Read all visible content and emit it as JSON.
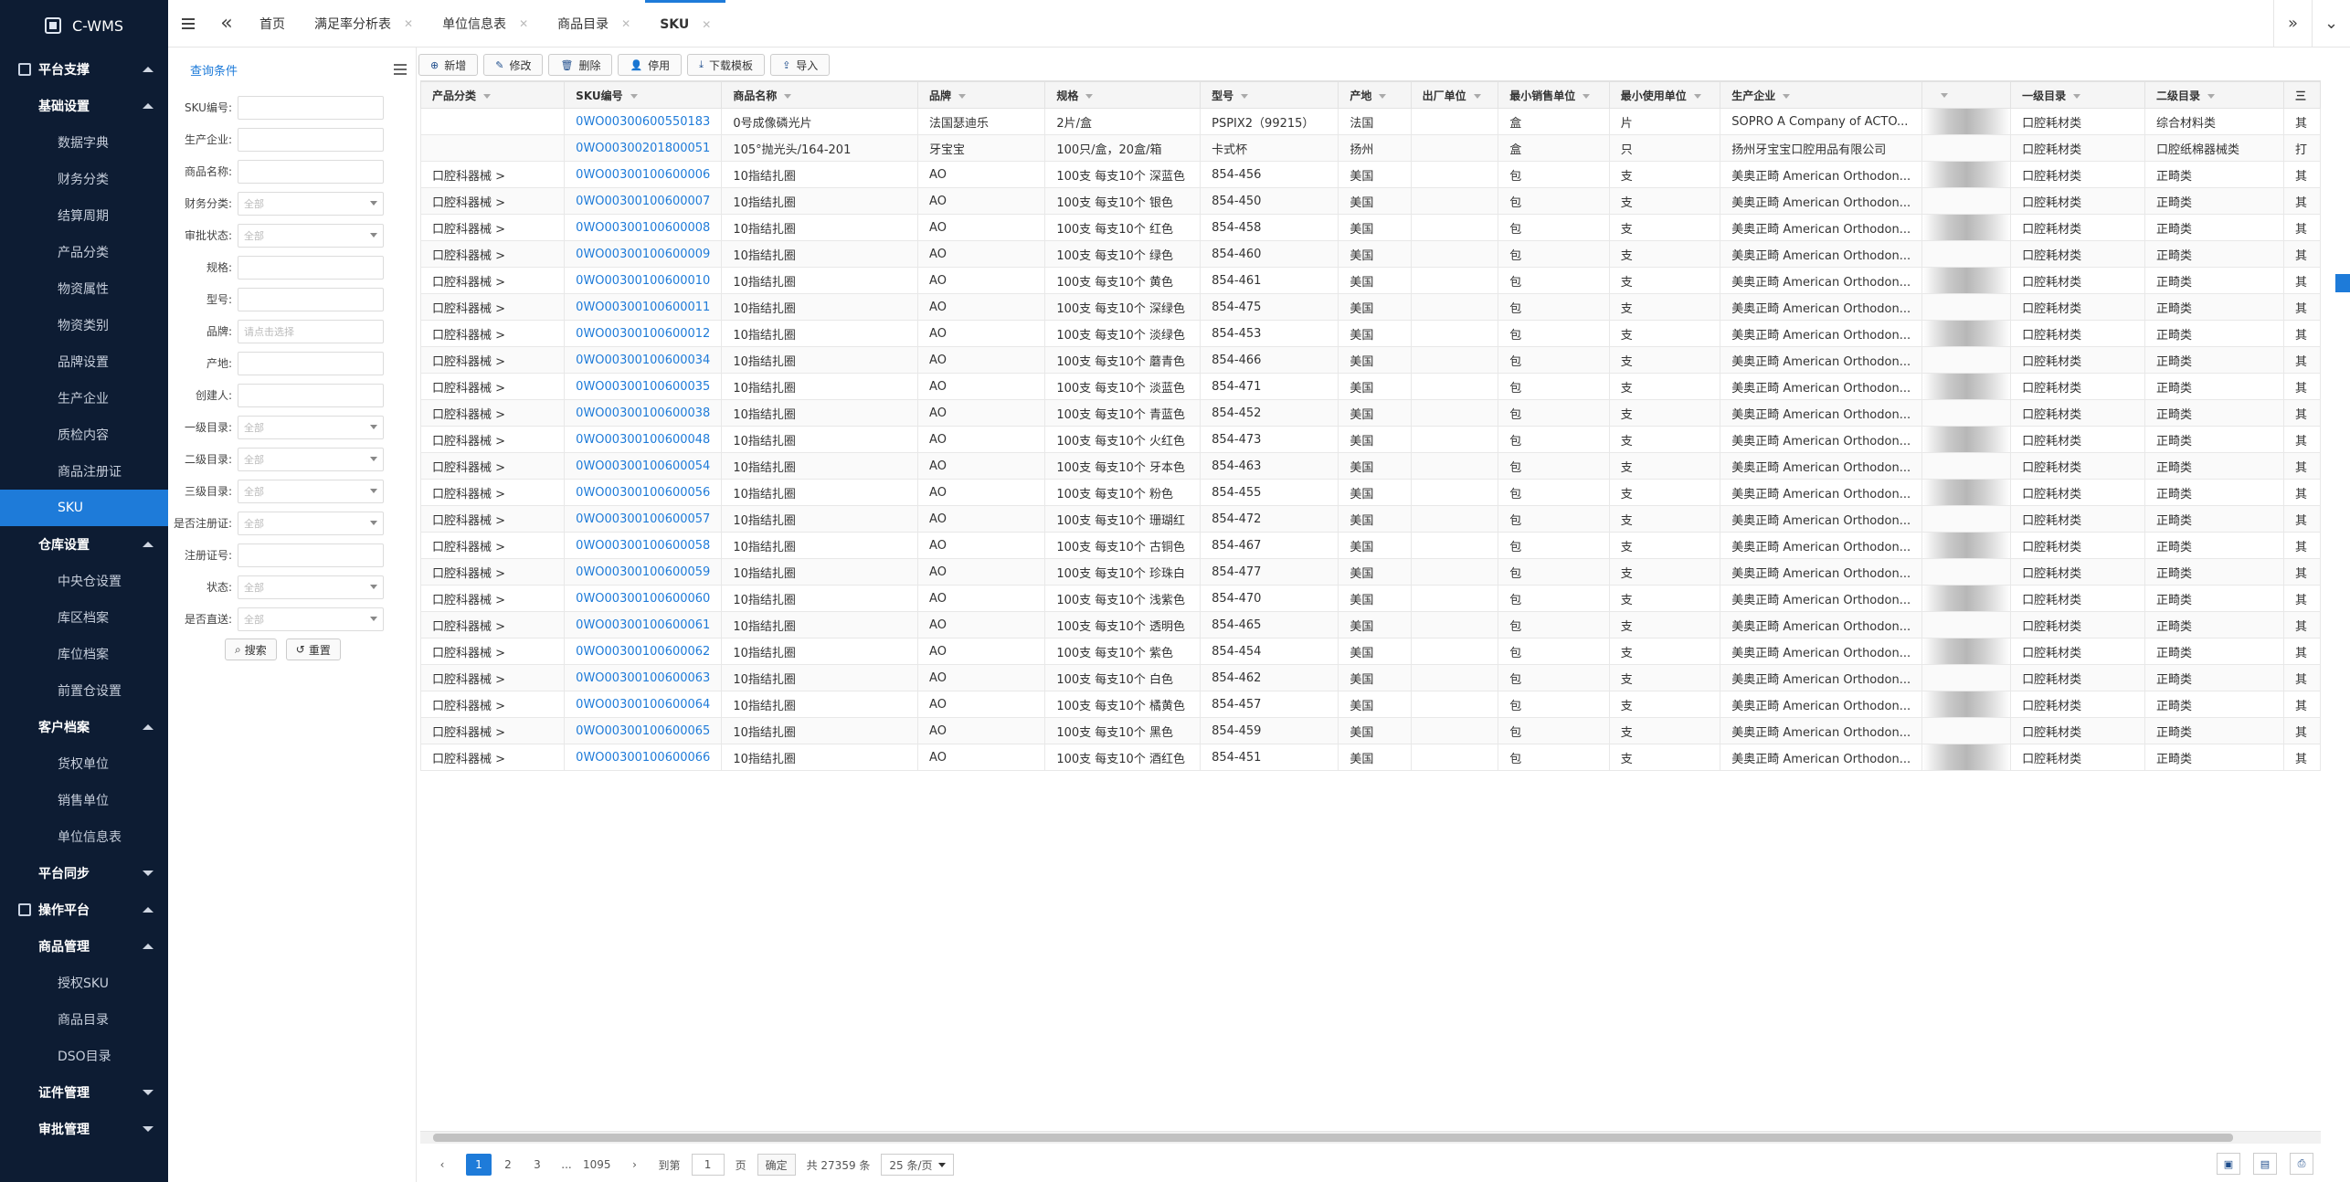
{
  "app": {
    "title": "C-WMS"
  },
  "sidebar": {
    "groups": [
      {
        "label": "平台支撑",
        "expanded": true
      },
      {
        "label": "操作平台",
        "expanded": true
      }
    ],
    "sections": [
      {
        "label": "基础设置",
        "expanded": true,
        "items": [
          "数据字典",
          "财务分类",
          "结算周期",
          "产品分类",
          "物资属性",
          "物资类别",
          "品牌设置",
          "生产企业",
          "质检内容",
          "商品注册证",
          "SKU"
        ]
      },
      {
        "label": "仓库设置",
        "expanded": true,
        "items": [
          "中央仓设置",
          "库区档案",
          "库位档案",
          "前置仓设置"
        ]
      },
      {
        "label": "客户档案",
        "expanded": true,
        "items": [
          "货权单位",
          "销售单位",
          "单位信息表"
        ]
      },
      {
        "label": "平台同步",
        "expanded": false,
        "items": []
      },
      {
        "label": "商品管理",
        "expanded": true,
        "items": [
          "授权SKU",
          "商品目录",
          "DSO目录"
        ]
      },
      {
        "label": "证件管理",
        "expanded": false,
        "items": []
      },
      {
        "label": "审批管理",
        "expanded": false,
        "items": []
      }
    ],
    "active_item": "SKU"
  },
  "tabs": [
    {
      "label": "首页",
      "closable": false
    },
    {
      "label": "满足率分析表",
      "closable": true
    },
    {
      "label": "单位信息表",
      "closable": true
    },
    {
      "label": "商品目录",
      "closable": true
    },
    {
      "label": "SKU",
      "closable": true,
      "active": true
    }
  ],
  "query": {
    "title": "查询条件",
    "fields": [
      {
        "label": "SKU编号:",
        "placeholder": ""
      },
      {
        "label": "生产企业:",
        "placeholder": ""
      },
      {
        "label": "商品名称:",
        "placeholder": ""
      },
      {
        "label": "财务分类:",
        "placeholder": "全部",
        "select": true
      },
      {
        "label": "审批状态:",
        "placeholder": "全部",
        "select": true
      },
      {
        "label": "规格:",
        "placeholder": ""
      },
      {
        "label": "型号:",
        "placeholder": ""
      },
      {
        "label": "品牌:",
        "placeholder": "请点击选择"
      },
      {
        "label": "产地:",
        "placeholder": ""
      },
      {
        "label": "创建人:",
        "placeholder": ""
      },
      {
        "label": "一级目录:",
        "placeholder": "全部",
        "select": true
      },
      {
        "label": "二级目录:",
        "placeholder": "全部",
        "select": true
      },
      {
        "label": "三级目录:",
        "placeholder": "全部",
        "select": true
      },
      {
        "label": "是否注册证:",
        "placeholder": "全部",
        "select": true
      },
      {
        "label": "注册证号:",
        "placeholder": ""
      },
      {
        "label": "状态:",
        "placeholder": "全部",
        "select": true
      },
      {
        "label": "是否直送:",
        "placeholder": "全部",
        "select": true
      }
    ],
    "search_label": "搜索",
    "reset_label": "重置"
  },
  "toolbar": {
    "add": "新增",
    "edit": "修改",
    "delete": "删除",
    "disable": "停用",
    "download": "下载模板",
    "import": "导入"
  },
  "table": {
    "columns": [
      "产品分类",
      "SKU编号",
      "商品名称",
      "品牌",
      "规格",
      "型号",
      "产地",
      "出厂单位",
      "最小销售单位",
      "最小使用单位",
      "生产企业",
      "",
      "一级目录",
      "二级目录",
      "三"
    ],
    "rows": [
      [
        "",
        "0WO00300600550183",
        "0号成像磷光片",
        "法国瑟迪乐",
        "2片/盒",
        "PSPIX2（99215）",
        "法国",
        "",
        "盒",
        "片",
        "SOPRO A Company of ACTO...",
        "",
        "口腔耗材类",
        "综合材料类",
        "其"
      ],
      [
        "",
        "0WO00300201800051",
        "105°抛光头/164-201",
        "牙宝宝",
        "100只/盒，20盒/箱",
        "卡式杯",
        "扬州",
        "",
        "盒",
        "只",
        "扬州牙宝宝口腔用品有限公司",
        "",
        "口腔耗材类",
        "口腔纸棉器械类",
        "打"
      ],
      [
        "口腔科器械 >",
        "0WO00300100600006",
        "10指结扎圈",
        "AO",
        "100支 每支10个 深蓝色",
        "854-456",
        "美国",
        "",
        "包",
        "支",
        "美奥正畸 American Orthodon...",
        "",
        "口腔耗材类",
        "正畸类",
        "其"
      ],
      [
        "口腔科器械 >",
        "0WO00300100600007",
        "10指结扎圈",
        "AO",
        "100支 每支10个 银色",
        "854-450",
        "美国",
        "",
        "包",
        "支",
        "美奥正畸 American Orthodon...",
        "",
        "口腔耗材类",
        "正畸类",
        "其"
      ],
      [
        "口腔科器械 >",
        "0WO00300100600008",
        "10指结扎圈",
        "AO",
        "100支 每支10个 红色",
        "854-458",
        "美国",
        "",
        "包",
        "支",
        "美奥正畸 American Orthodon...",
        "",
        "口腔耗材类",
        "正畸类",
        "其"
      ],
      [
        "口腔科器械 >",
        "0WO00300100600009",
        "10指结扎圈",
        "AO",
        "100支 每支10个 绿色",
        "854-460",
        "美国",
        "",
        "包",
        "支",
        "美奥正畸 American Orthodon...",
        "",
        "口腔耗材类",
        "正畸类",
        "其"
      ],
      [
        "口腔科器械 >",
        "0WO00300100600010",
        "10指结扎圈",
        "AO",
        "100支 每支10个 黄色",
        "854-461",
        "美国",
        "",
        "包",
        "支",
        "美奥正畸 American Orthodon...",
        "",
        "口腔耗材类",
        "正畸类",
        "其"
      ],
      [
        "口腔科器械 >",
        "0WO00300100600011",
        "10指结扎圈",
        "AO",
        "100支 每支10个 深绿色",
        "854-475",
        "美国",
        "",
        "包",
        "支",
        "美奥正畸 American Orthodon...",
        "",
        "口腔耗材类",
        "正畸类",
        "其"
      ],
      [
        "口腔科器械 >",
        "0WO00300100600012",
        "10指结扎圈",
        "AO",
        "100支 每支10个 淡绿色",
        "854-453",
        "美国",
        "",
        "包",
        "支",
        "美奥正畸 American Orthodon...",
        "",
        "口腔耗材类",
        "正畸类",
        "其"
      ],
      [
        "口腔科器械 >",
        "0WO00300100600034",
        "10指结扎圈",
        "AO",
        "100支 每支10个 蘑青色",
        "854-466",
        "美国",
        "",
        "包",
        "支",
        "美奥正畸 American Orthodon...",
        "",
        "口腔耗材类",
        "正畸类",
        "其"
      ],
      [
        "口腔科器械 >",
        "0WO00300100600035",
        "10指结扎圈",
        "AO",
        "100支 每支10个 淡蓝色",
        "854-471",
        "美国",
        "",
        "包",
        "支",
        "美奥正畸 American Orthodon...",
        "",
        "口腔耗材类",
        "正畸类",
        "其"
      ],
      [
        "口腔科器械 >",
        "0WO00300100600038",
        "10指结扎圈",
        "AO",
        "100支 每支10个 青蓝色",
        "854-452",
        "美国",
        "",
        "包",
        "支",
        "美奥正畸 American Orthodon...",
        "",
        "口腔耗材类",
        "正畸类",
        "其"
      ],
      [
        "口腔科器械 >",
        "0WO00300100600048",
        "10指结扎圈",
        "AO",
        "100支 每支10个 火红色",
        "854-473",
        "美国",
        "",
        "包",
        "支",
        "美奥正畸 American Orthodon...",
        "",
        "口腔耗材类",
        "正畸类",
        "其"
      ],
      [
        "口腔科器械 >",
        "0WO00300100600054",
        "10指结扎圈",
        "AO",
        "100支 每支10个 牙本色",
        "854-463",
        "美国",
        "",
        "包",
        "支",
        "美奥正畸 American Orthodon...",
        "",
        "口腔耗材类",
        "正畸类",
        "其"
      ],
      [
        "口腔科器械 >",
        "0WO00300100600056",
        "10指结扎圈",
        "AO",
        "100支 每支10个 粉色",
        "854-455",
        "美国",
        "",
        "包",
        "支",
        "美奥正畸 American Orthodon...",
        "",
        "口腔耗材类",
        "正畸类",
        "其"
      ],
      [
        "口腔科器械 >",
        "0WO00300100600057",
        "10指结扎圈",
        "AO",
        "100支 每支10个 珊瑚红",
        "854-472",
        "美国",
        "",
        "包",
        "支",
        "美奥正畸 American Orthodon...",
        "",
        "口腔耗材类",
        "正畸类",
        "其"
      ],
      [
        "口腔科器械 >",
        "0WO00300100600058",
        "10指结扎圈",
        "AO",
        "100支 每支10个 古铜色",
        "854-467",
        "美国",
        "",
        "包",
        "支",
        "美奥正畸 American Orthodon...",
        "",
        "口腔耗材类",
        "正畸类",
        "其"
      ],
      [
        "口腔科器械 >",
        "0WO00300100600059",
        "10指结扎圈",
        "AO",
        "100支 每支10个 珍珠白",
        "854-477",
        "美国",
        "",
        "包",
        "支",
        "美奥正畸 American Orthodon...",
        "",
        "口腔耗材类",
        "正畸类",
        "其"
      ],
      [
        "口腔科器械 >",
        "0WO00300100600060",
        "10指结扎圈",
        "AO",
        "100支 每支10个 浅紫色",
        "854-470",
        "美国",
        "",
        "包",
        "支",
        "美奥正畸 American Orthodon...",
        "",
        "口腔耗材类",
        "正畸类",
        "其"
      ],
      [
        "口腔科器械 >",
        "0WO00300100600061",
        "10指结扎圈",
        "AO",
        "100支 每支10个 透明色",
        "854-465",
        "美国",
        "",
        "包",
        "支",
        "美奥正畸 American Orthodon...",
        "",
        "口腔耗材类",
        "正畸类",
        "其"
      ],
      [
        "口腔科器械 >",
        "0WO00300100600062",
        "10指结扎圈",
        "AO",
        "100支 每支10个 紫色",
        "854-454",
        "美国",
        "",
        "包",
        "支",
        "美奥正畸 American Orthodon...",
        "",
        "口腔耗材类",
        "正畸类",
        "其"
      ],
      [
        "口腔科器械 >",
        "0WO00300100600063",
        "10指结扎圈",
        "AO",
        "100支 每支10个 白色",
        "854-462",
        "美国",
        "",
        "包",
        "支",
        "美奥正畸 American Orthodon...",
        "",
        "口腔耗材类",
        "正畸类",
        "其"
      ],
      [
        "口腔科器械 >",
        "0WO00300100600064",
        "10指结扎圈",
        "AO",
        "100支 每支10个 橘黄色",
        "854-457",
        "美国",
        "",
        "包",
        "支",
        "美奥正畸 American Orthodon...",
        "",
        "口腔耗材类",
        "正畸类",
        "其"
      ],
      [
        "口腔科器械 >",
        "0WO00300100600065",
        "10指结扎圈",
        "AO",
        "100支 每支10个 黑色",
        "854-459",
        "美国",
        "",
        "包",
        "支",
        "美奥正畸 American Orthodon...",
        "",
        "口腔耗材类",
        "正畸类",
        "其"
      ],
      [
        "口腔科器械 >",
        "0WO00300100600066",
        "10指结扎圈",
        "AO",
        "100支 每支10个 酒红色",
        "854-451",
        "美国",
        "",
        "包",
        "支",
        "美奥正畸 American Orthodon...",
        "",
        "口腔耗材类",
        "正畸类",
        "其"
      ]
    ]
  },
  "pagination": {
    "pages": [
      "1",
      "2",
      "3",
      "...",
      "1095"
    ],
    "current": "1",
    "goto_label": "到第",
    "goto_value": "1",
    "page_suffix": "页",
    "confirm_label": "确定",
    "total_label": "共 27359 条",
    "page_size_label": "25 条/页"
  },
  "colors": {
    "sidebar_bg": "#0d1c33",
    "accent": "#1e7bd9",
    "link": "#1e7bd9"
  }
}
